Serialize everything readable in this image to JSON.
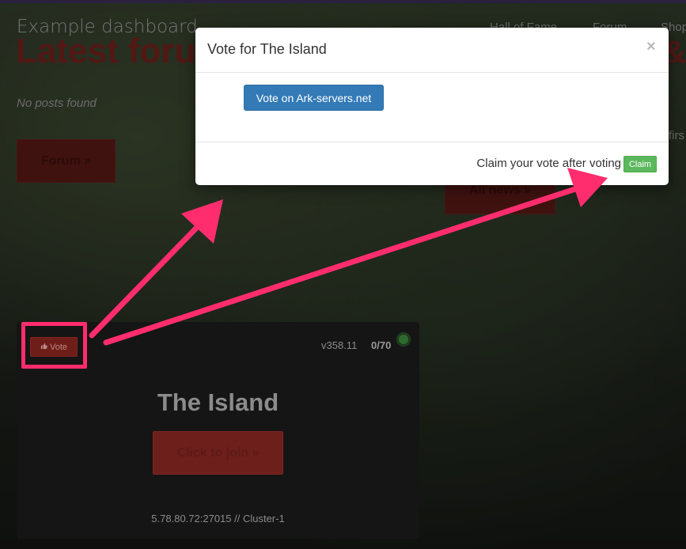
{
  "navbar": {
    "brand": "Example dashboard",
    "links": [
      "Hall of Fame",
      "Forum",
      "Shop"
    ]
  },
  "page": {
    "latest_title": "Latest foru",
    "right_title_peek": "&",
    "no_posts": "No posts found",
    "right_text_peek": "firs",
    "forum_button": "Forum »",
    "all_news_button": "All news »"
  },
  "server": {
    "vote_button": "Vote",
    "version": "v358.11",
    "players": "0/70",
    "name": "The Island",
    "join_button": "Click to join »",
    "address": "5.78.80.72:27015 // Cluster-1"
  },
  "modal": {
    "title": "Vote for The Island",
    "close": "×",
    "vote_site_button": "Vote on Ark-servers.net",
    "claim_text": "Claim your vote after voting",
    "claim_button": "Claim"
  },
  "colors": {
    "accent_arrow": "#ff2d6e",
    "primary": "#337ab7",
    "success": "#5cb85c",
    "danger": "#8e2a24"
  },
  "icons": {
    "vote": "thumbs-up-icon",
    "status": "online-status-icon"
  }
}
